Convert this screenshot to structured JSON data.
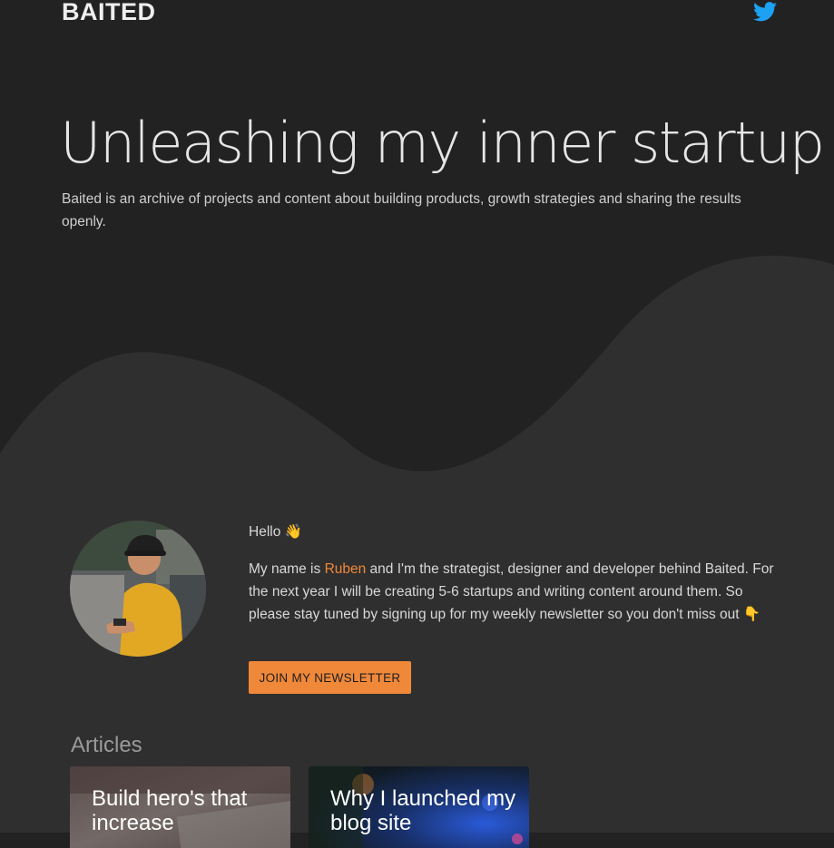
{
  "header": {
    "logo": "BAITED",
    "social_icon": "twitter-icon",
    "social_color": "#1da1f2"
  },
  "hero": {
    "title": "Unleashing my inner startup",
    "subtitle": "Baited is an archive of projects and content about building products, growth strategies and sharing the results openly."
  },
  "about": {
    "greeting": "Hello 👋",
    "intro_before": "My name is ",
    "name": "Ruben",
    "intro_after": " and I'm the strategist, designer and developer behind Baited. For the next year I will be creating 5-6 startups and writing content around them. So please stay tuned by signing up for my weekly newsletter so you don't miss out 👇",
    "button_label": "JOIN MY NEWSLETTER"
  },
  "articles": {
    "heading": "Articles",
    "items": [
      {
        "title": "Build hero's that increase"
      },
      {
        "title": "Why I launched my blog site"
      }
    ]
  },
  "colors": {
    "background": "#222222",
    "wave": "#2f2f2f",
    "accent": "#f0883a"
  }
}
